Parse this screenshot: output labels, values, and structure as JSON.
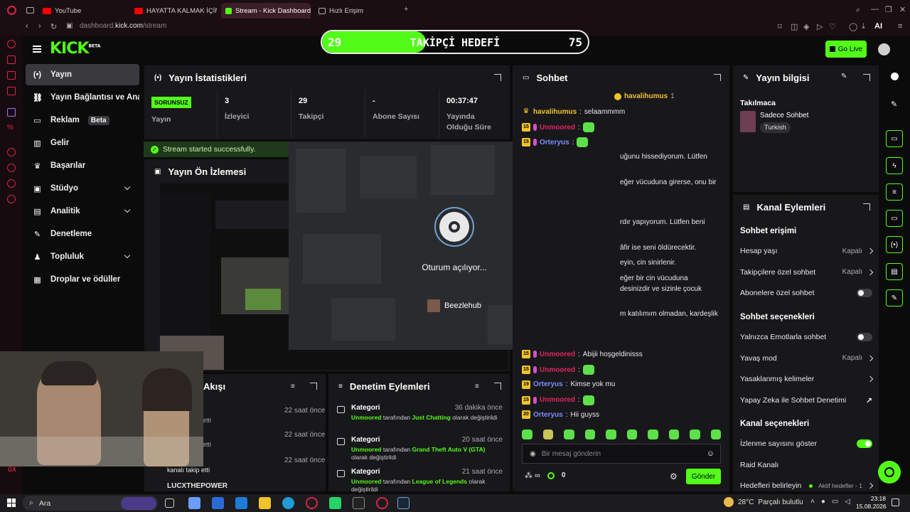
{
  "browser": {
    "tabs": [
      {
        "title": "YouTube"
      },
      {
        "title": "HAYATTA KALMAK İÇİN AI"
      },
      {
        "title": "Stream - Kick Dashboard"
      },
      {
        "title": "Hızlı Erişim"
      }
    ],
    "url_prefix": "dashboard.",
    "url_host": "kick.com",
    "url_path": "/stream",
    "ai_label": "AI"
  },
  "header": {
    "logo": "KICK",
    "logo_badge": "BETA",
    "goal": {
      "current": "29",
      "label": "TAKİPÇİ HEDEFİ",
      "target": "75",
      "progress": 0.39
    },
    "go_live": "Go Live"
  },
  "nav": {
    "items": [
      {
        "label": "Yayın",
        "icon": "broadcast-icon",
        "active": true
      },
      {
        "label": "Yayın Bağlantısı ve Anahtarı",
        "icon": "link-icon"
      },
      {
        "label": "Reklam",
        "icon": "ad-icon",
        "badge": "Beta"
      },
      {
        "label": "Gelir",
        "icon": "chart-icon"
      },
      {
        "label": "Başarılar",
        "icon": "trophy-icon"
      },
      {
        "label": "Stüdyo",
        "icon": "studio-icon",
        "expandable": true
      },
      {
        "label": "Analitik",
        "icon": "analytics-icon",
        "expandable": true
      },
      {
        "label": "Denetleme",
        "icon": "wrench-icon"
      },
      {
        "label": "Topluluk",
        "icon": "community-icon",
        "expandable": true
      },
      {
        "label": "Droplar ve ödüller",
        "icon": "gift-icon"
      }
    ]
  },
  "stats": {
    "title": "Yayın İstatistikleri",
    "status_badge": "SORUNSUZ",
    "status_label": "Yayın",
    "items": [
      {
        "value": "3",
        "label": "İzleyici"
      },
      {
        "value": "29",
        "label": "Takipçi"
      },
      {
        "value": "-",
        "label": "Abone Sayısı"
      },
      {
        "value": "00:37:47",
        "label": "Yayında Olduğu Süre"
      }
    ],
    "toast": "Stream started successfully."
  },
  "preview": {
    "title": "Yayın Ön İzlemesi"
  },
  "steam_overlay": {
    "message": "Oturum açılıyor...",
    "user": "Beezlehub"
  },
  "activity": {
    "title": "Akışı",
    "rows": [
      {
        "time": "22 saat önce",
        "text": "etti"
      },
      {
        "time": "22 saat önce",
        "text": "etti"
      },
      {
        "time": "22 saat önce",
        "text": "kanalı takip etti"
      },
      {
        "time": "",
        "text": "LUCXTHEPOWER"
      }
    ]
  },
  "moderation": {
    "title": "Denetim Eylemleri",
    "rows": [
      {
        "kind": "Kategori",
        "time": "36 dakika önce",
        "user": "Unmoored",
        "mid": " tarafından ",
        "value": "Just Chatting",
        "tail": " olarak değiştirildi"
      },
      {
        "kind": "Kategori",
        "time": "20 saat önce",
        "user": "Unmoored",
        "mid": " tarafından ",
        "value": "Grand Theft Auto V (GTA)",
        "tail": " olarak değiştirildi"
      },
      {
        "kind": "Kategori",
        "time": "21 saat önce",
        "user": "Unmoored",
        "mid": " tarafından ",
        "value": "League of Legends",
        "tail": " olarak değiştirildi"
      }
    ]
  },
  "chat": {
    "title": "Sohbet",
    "pinned_user": "havalihumus",
    "pinned_count": "1",
    "lines": [
      {
        "user": "havalihumus",
        "text": "selaammmm",
        "color": "#f1c22b",
        "badge": "crown"
      },
      {
        "user": "Unmoored",
        "text": "",
        "color": "#e0245e",
        "badge": "15",
        "mic": true,
        "emote": true
      },
      {
        "user": "Orteryus",
        "text": "",
        "color": "#7b8cff",
        "badge": "15",
        "mic": true,
        "emote": true
      }
    ],
    "bot_fragments": [
      "uğunu hissediyorum. Lütfen",
      "eğer vücuduna girerse, onu bir",
      "rdır yapıyorum. Lütfen beni",
      "âfir ise seni öldürecektir.",
      "eyin, cin sinirlenir.",
      "eğer bir cin vücuduna",
      "desinizdir ve sizinle çocuk",
      "m katılımım olmadan, kardeşlik"
    ],
    "recent": [
      {
        "badge": "15",
        "user": "Unmoored",
        "text": "Abijii hoşgeldinisss",
        "color": "#e0245e",
        "mic": true
      },
      {
        "badge": "15",
        "user": "Unmoored",
        "text": "",
        "color": "#e0245e",
        "mic": true,
        "emote": true
      },
      {
        "badge": "19",
        "user": "Orteryus",
        "text": "Kimse yok mu",
        "color": "#7b8cff"
      },
      {
        "badge": "15",
        "user": "Unmoored",
        "text": "",
        "color": "#e0245e",
        "mic": true,
        "emote": true
      },
      {
        "badge": "20",
        "user": "Orteryus",
        "text": "Hii guyss",
        "color": "#7b8cff"
      }
    ],
    "input_placeholder": "Bir mesaj gönderin",
    "points": "0",
    "send": "Gönder"
  },
  "stream_info": {
    "title": "Yayın bilgisi",
    "tag_label": "Takılmaca",
    "category": "Sadece Sohbet",
    "language": "Turkish"
  },
  "channel_actions": {
    "title": "Kanal Eylemleri",
    "chat_access_title": "Sohbet erişimi",
    "access_rows": [
      {
        "label": "Hesap yaşı",
        "value": "Kapalı",
        "type": "chevron"
      },
      {
        "label": "Takipçilere özel sohbet",
        "value": "Kapalı",
        "type": "chevron"
      },
      {
        "label": "Abonelere özel sohbet",
        "value": "",
        "type": "toggle",
        "on": false
      }
    ],
    "chat_options_title": "Sohbet seçenekleri",
    "option_rows": [
      {
        "label": "Yalnızca Emotlarla sohbet",
        "value": "",
        "type": "toggle",
        "on": false
      },
      {
        "label": "Yavaş mod",
        "value": "Kapalı",
        "type": "chevron"
      },
      {
        "label": "Yasaklanmış kelimeler",
        "value": "",
        "type": "chevron"
      },
      {
        "label": "Yapay Zeka ile Sohbet Denetimi",
        "value": "",
        "type": "external"
      }
    ],
    "channel_options_title": "Kanal seçenekleri",
    "channel_rows": [
      {
        "label": "İzlenme sayısını göster",
        "value": "",
        "type": "toggle",
        "on": true
      },
      {
        "label": "Raid Kanalı",
        "value": "",
        "type": "none"
      },
      {
        "label": "Hedefleri belirleyin",
        "value": "Aktif hedefler - 1",
        "type": "chevron"
      }
    ]
  },
  "taskbar": {
    "search": "Ara",
    "weather_temp": "28°C",
    "weather_text": "Parçalı bulutlu",
    "time": "23:18",
    "date": "15.08.2026"
  },
  "corner_badge": "GX",
  "colors": {
    "accent": "#53fc18",
    "panel": "#18181b",
    "bg": "#0b0b0c",
    "opera": "#d9234a"
  }
}
